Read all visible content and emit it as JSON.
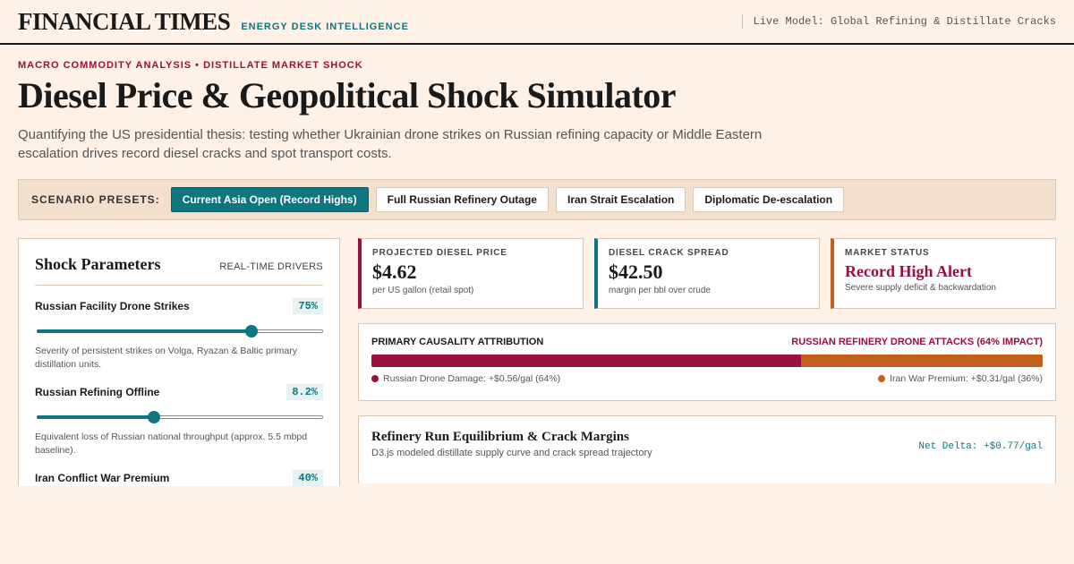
{
  "header": {
    "logo": "FINANCIAL TIMES",
    "desk": "ENERGY DESK INTELLIGENCE",
    "live_model": "Live Model: Global Refining & Distillate Cracks"
  },
  "article": {
    "kicker": "MACRO COMMODITY ANALYSIS • DISTILLATE MARKET SHOCK",
    "title": "Diesel Price & Geopolitical Shock Simulator",
    "standfirst": "Quantifying the US presidential thesis: testing whether Ukrainian drone strikes on Russian refining capacity or Middle Eastern escalation drives record diesel cracks and spot transport costs."
  },
  "presets": {
    "label": "SCENARIO PRESETS:",
    "items": [
      {
        "label": "Current Asia Open (Record Highs)",
        "active": true
      },
      {
        "label": "Full Russian Refinery Outage",
        "active": false
      },
      {
        "label": "Iran Strait Escalation",
        "active": false
      },
      {
        "label": "Diplomatic De-escalation",
        "active": false
      }
    ]
  },
  "params": {
    "title": "Shock Parameters",
    "subtitle": "REAL-TIME DRIVERS",
    "items": [
      {
        "name": "Russian Facility Drone Strikes",
        "value": "75%",
        "level": 0.75,
        "desc": "Severity of persistent strikes on Volga, Ryazan & Baltic primary distillation units."
      },
      {
        "name": "Russian Refining Offline",
        "value": "8.2%",
        "level": 0.41,
        "desc": "Equivalent loss of Russian national throughput (approx. 5.5 mbpd baseline)."
      },
      {
        "name": "Iran Conflict War Premium",
        "value": "40%",
        "level": 0.4,
        "desc": ""
      }
    ]
  },
  "kpis": {
    "price": {
      "label": "PROJECTED DIESEL PRICE",
      "value": "$4.62",
      "note": "per US gallon (retail spot)"
    },
    "crack": {
      "label": "DIESEL CRACK SPREAD",
      "value": "$42.50",
      "note": "margin per bbl over crude"
    },
    "status": {
      "label": "MARKET STATUS",
      "value": "Record High Alert",
      "note": "Severe supply deficit & backwardation"
    }
  },
  "attribution": {
    "title": "PRIMARY CAUSALITY ATTRIBUTION",
    "impact": "RUSSIAN REFINERY DRONE ATTACKS (64% IMPACT)",
    "drone_share": 0.64,
    "iran_share": 0.36,
    "drone_color": "#990f3d",
    "iran_color": "#c4601b",
    "drone_legend": "Russian Drone Damage: +$0.56/gal (64%)",
    "iran_legend": "Iran War Premium: +$0.31/gal (36%)"
  },
  "equilibrium": {
    "title": "Refinery Run Equilibrium & Crack Margins",
    "subtitle": "D3.js modeled distillate supply curve and crack spread trajectory",
    "delta": "Net Delta: +$0.77/gal"
  },
  "colors": {
    "accent": "#0d7680",
    "claret": "#990f3d",
    "background": "#fff1e5"
  }
}
